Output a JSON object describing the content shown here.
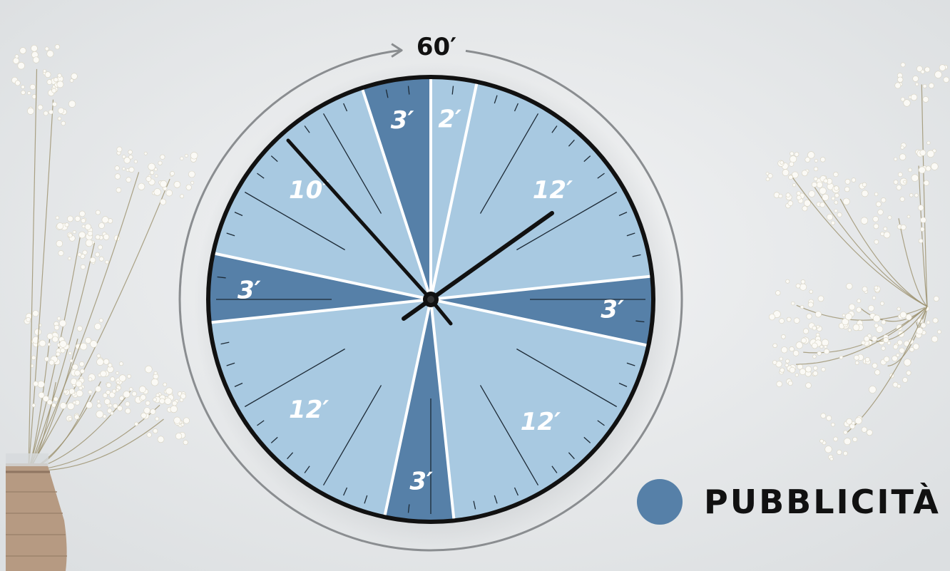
{
  "chart_data": {
    "type": "pie",
    "total_label": "60′",
    "segments": [
      {
        "label": "2′",
        "minutes": 2,
        "category": "content"
      },
      {
        "label": "12′",
        "minutes": 12,
        "category": "content"
      },
      {
        "label": "3′",
        "minutes": 3,
        "category": "advertising"
      },
      {
        "label": "12′",
        "minutes": 12,
        "category": "content"
      },
      {
        "label": "3′",
        "minutes": 3,
        "category": "advertising"
      },
      {
        "label": "12′",
        "minutes": 12,
        "category": "content"
      },
      {
        "label": "3′",
        "minutes": 3,
        "category": "advertising"
      },
      {
        "label": "10′",
        "minutes": 10,
        "category": "content"
      },
      {
        "label": "3′",
        "minutes": 3,
        "category": "advertising"
      }
    ],
    "legend": [
      {
        "label": "PUBBLICITÀ",
        "category": "advertising"
      }
    ],
    "colors": {
      "content": "#a8c9e1",
      "advertising": "#5680a8",
      "divider": "#ffffff",
      "rim": "#111111"
    }
  },
  "icons": {
    "flower-left": "baby-breath-flowers",
    "flower-right": "baby-breath-flowers",
    "vase": "jute-vase"
  }
}
